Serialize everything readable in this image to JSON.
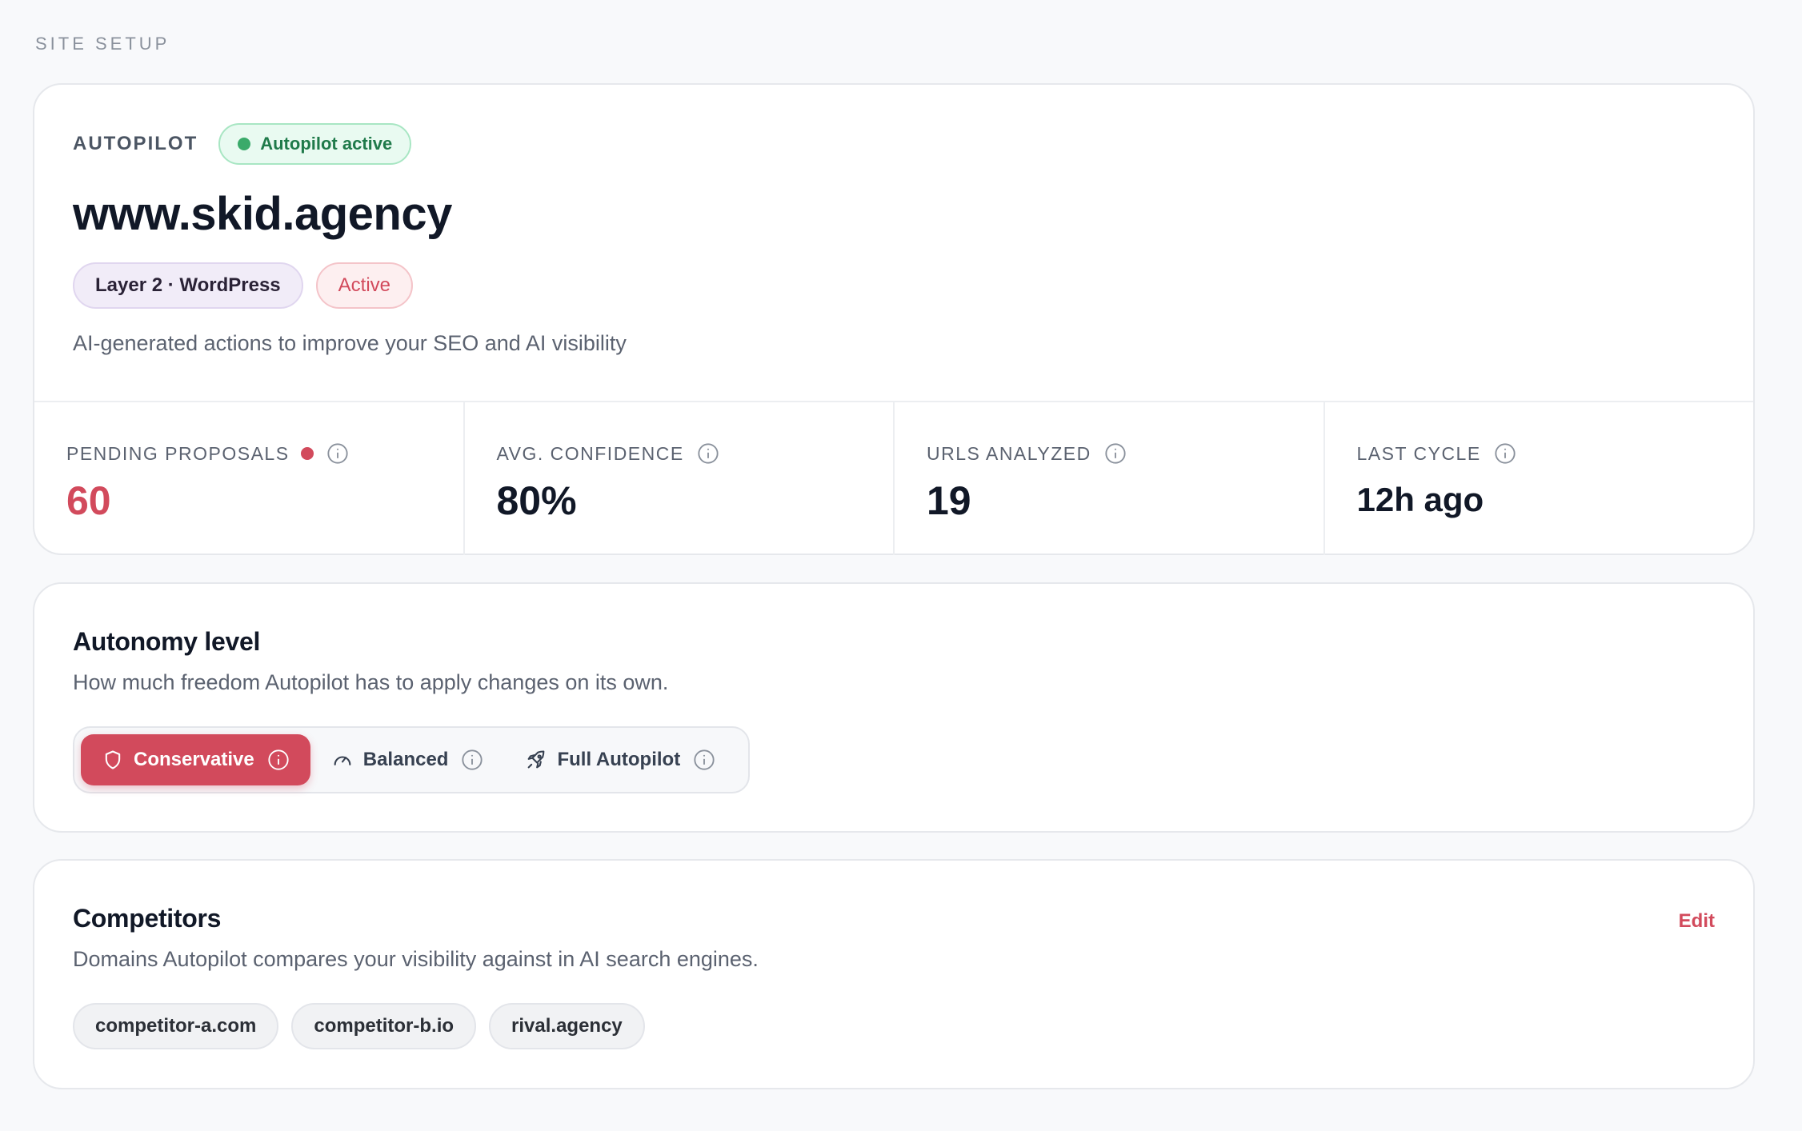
{
  "section_label": "SITE SETUP",
  "autopilot": {
    "eyebrow": "AUTOPILOT",
    "status": "Autopilot active",
    "domain": "www.skid.agency",
    "tags": {
      "layer": "Layer 2 · WordPress",
      "state": "Active"
    },
    "description": "AI-generated actions to improve your SEO and AI visibility",
    "stats": [
      {
        "label": "PENDING PROPOSALS",
        "value": "60",
        "icon": "info-icon"
      },
      {
        "label": "AVG. CONFIDENCE",
        "value": "80%",
        "icon": "info-icon"
      },
      {
        "label": "URLS ANALYZED",
        "value": "19",
        "icon": "info-icon"
      },
      {
        "label": "LAST CYCLE",
        "value": "12h ago",
        "icon": "info-icon"
      }
    ]
  },
  "autonomy": {
    "title": "Autonomy level",
    "description": "How much freedom Autopilot has to apply changes on its own.",
    "options": [
      {
        "label": "Conservative",
        "icon": "shield-icon",
        "selected": true
      },
      {
        "label": "Balanced",
        "icon": "gauge-icon",
        "selected": false
      },
      {
        "label": "Full Autopilot",
        "icon": "rocket-icon",
        "selected": false
      }
    ]
  },
  "competitors": {
    "title": "Competitors",
    "edit_label": "Edit",
    "description": "Domains Autopilot compares your visibility against in AI search engines.",
    "domains": [
      "competitor-a.com",
      "competitor-b.io",
      "rival.agency"
    ]
  },
  "colors": {
    "accent": "#d24a5c",
    "success": "#3aaa6a",
    "success_bg": "#e9faf1",
    "page_bg": "#f8f9fb"
  }
}
